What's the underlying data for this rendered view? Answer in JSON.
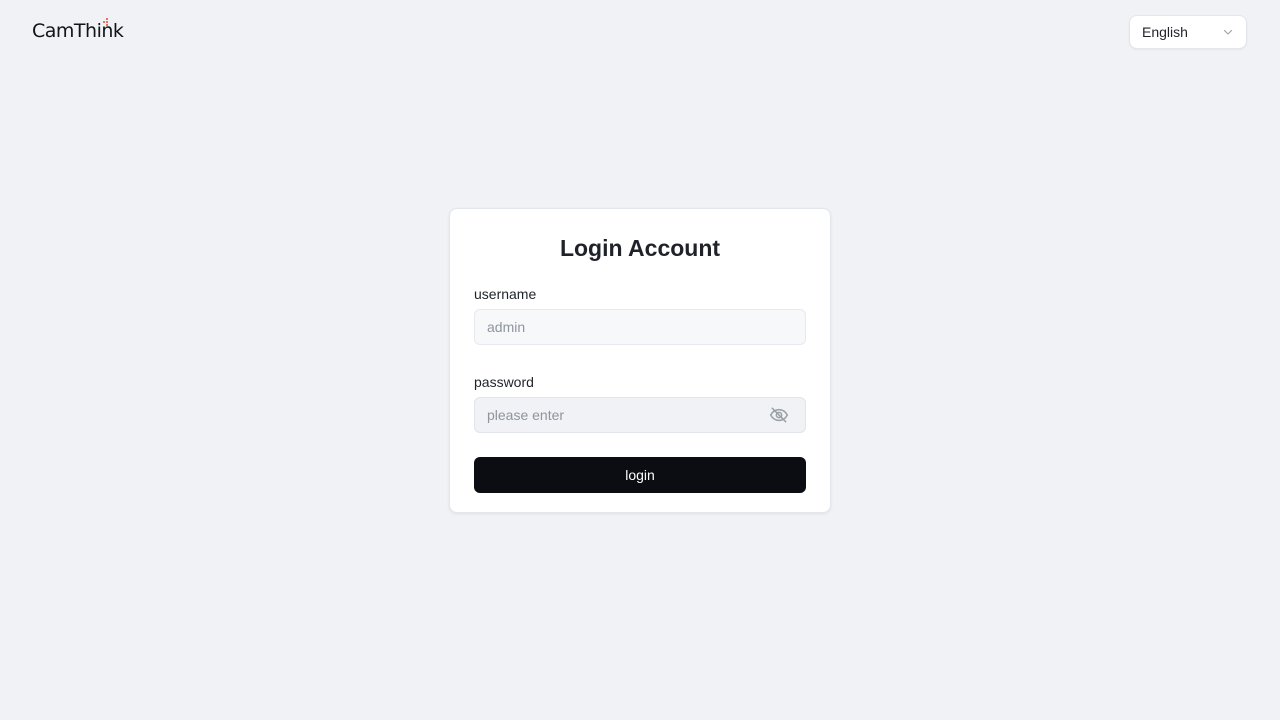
{
  "header": {
    "logo_text": "CamThink",
    "logo_icon": "camthink-logo",
    "language": {
      "selected": "English",
      "icon": "chevron-down-icon"
    }
  },
  "login": {
    "title": "Login Account",
    "username": {
      "label": "username",
      "value": "",
      "placeholder": "admin"
    },
    "password": {
      "label": "password",
      "value": "",
      "placeholder": "please enter",
      "toggle_icon": "eye-off-icon"
    },
    "submit_label": "login"
  },
  "colors": {
    "background": "#f0f2f5",
    "card": "#ffffff",
    "primary_button": "#0b0d12",
    "logo_accent": "#e5482b",
    "placeholder_text": "#8f959e"
  }
}
